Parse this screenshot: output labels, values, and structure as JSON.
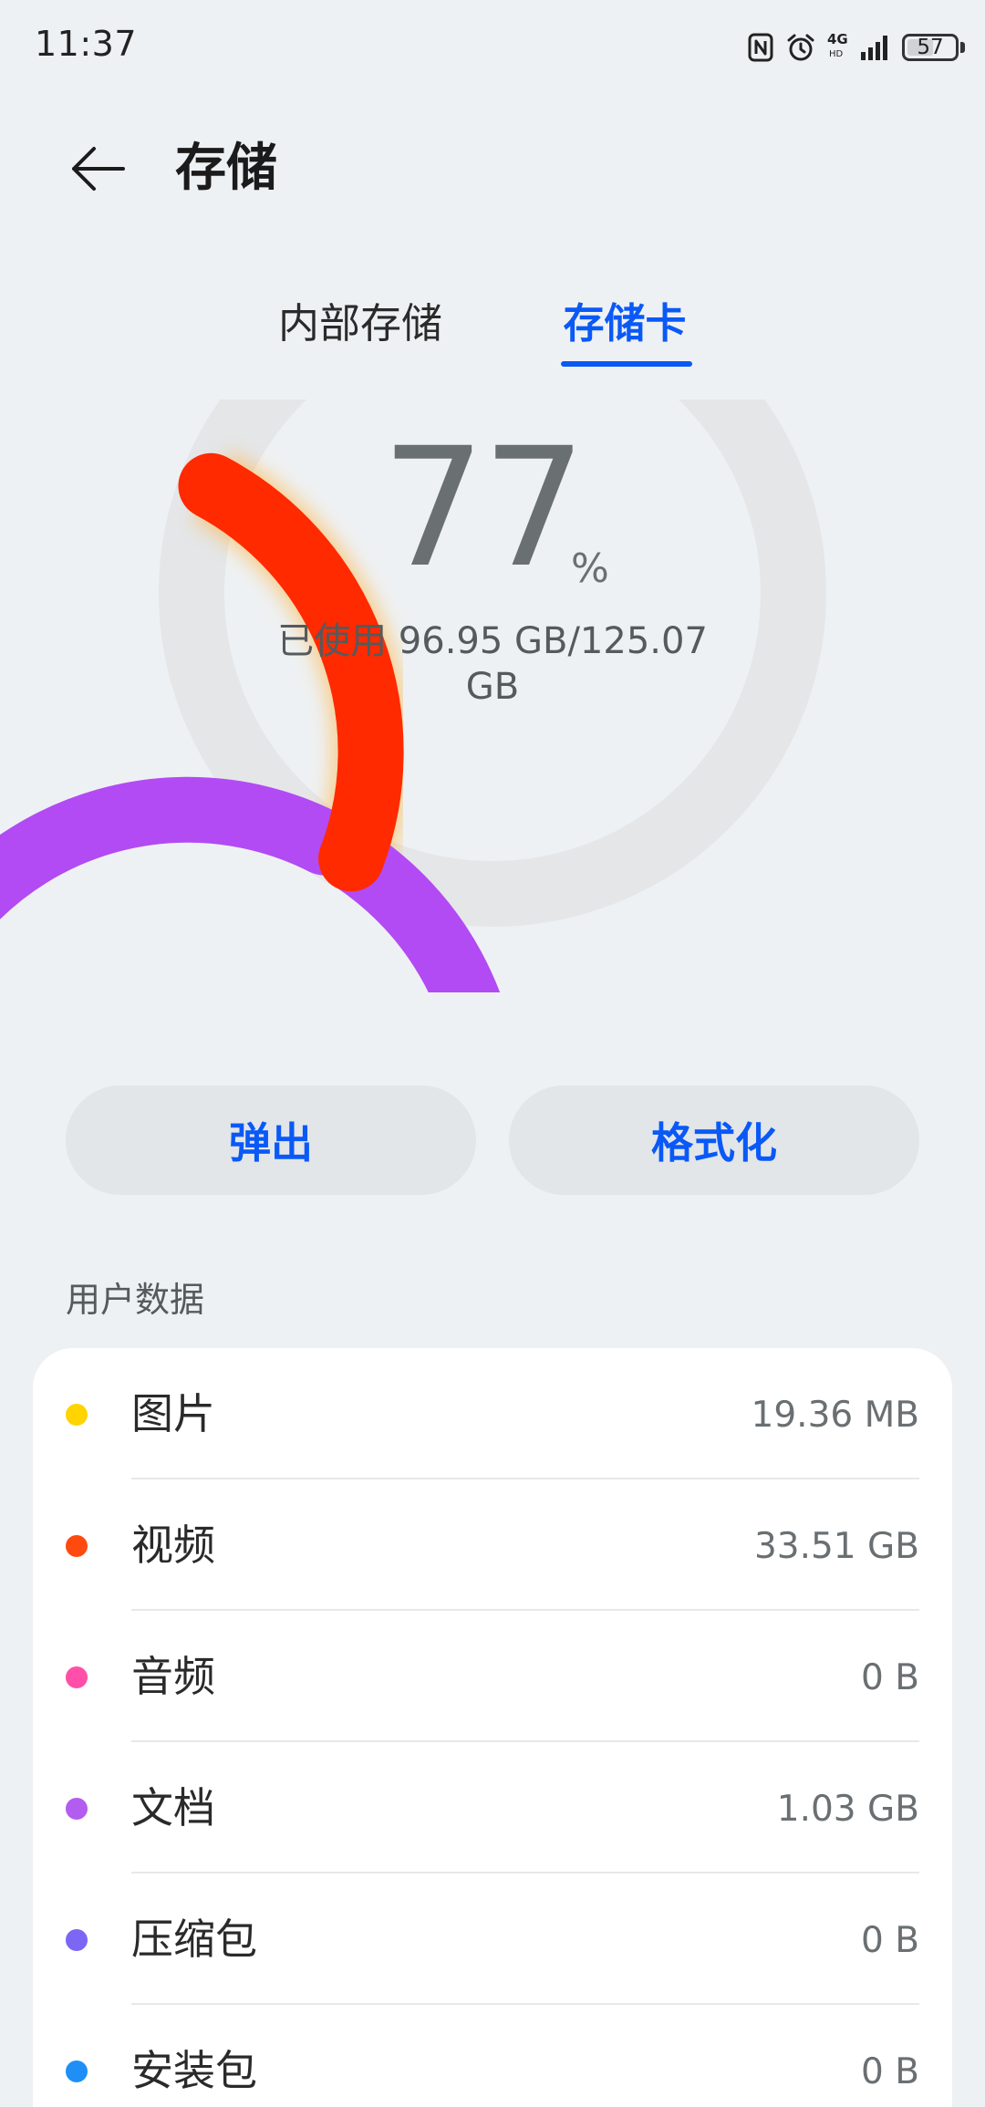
{
  "status_bar": {
    "time": "11:37",
    "network": "4G",
    "network_sub": "HD",
    "battery": "57",
    "battery_level": 0.57,
    "icons": [
      "nfc-icon",
      "alarm-clock-icon",
      "signal-icon",
      "battery-icon"
    ]
  },
  "header": {
    "title": "存储",
    "back_icon": "arrow-left-icon"
  },
  "tabs": {
    "internal": "内部存储",
    "sdcard": "存储卡",
    "active": "sdcard"
  },
  "usage": {
    "percent": "77",
    "percent_sign": "%",
    "used_text": "已使用 96.95 GB/125.07 GB",
    "fraction": 0.77,
    "colors": {
      "track": "#e4e6e8",
      "main": "#ff2a00",
      "main_start": "#ff4a1a",
      "accent": "#b24bf3"
    }
  },
  "actions": {
    "eject": "弹出",
    "format": "格式化"
  },
  "section": {
    "title": "用户数据"
  },
  "items": [
    {
      "label": "图片",
      "value": "19.36 MB",
      "color": "#ffd400"
    },
    {
      "label": "视频",
      "value": "33.51 GB",
      "color": "#ff4a0f"
    },
    {
      "label": "音频",
      "value": "0 B",
      "color": "#ff4fa8"
    },
    {
      "label": "文档",
      "value": "1.03 GB",
      "color": "#b35cf0"
    },
    {
      "label": "压缩包",
      "value": "0 B",
      "color": "#7b66f5"
    },
    {
      "label": "安装包",
      "value": "0 B",
      "color": "#1f8ff5"
    }
  ]
}
